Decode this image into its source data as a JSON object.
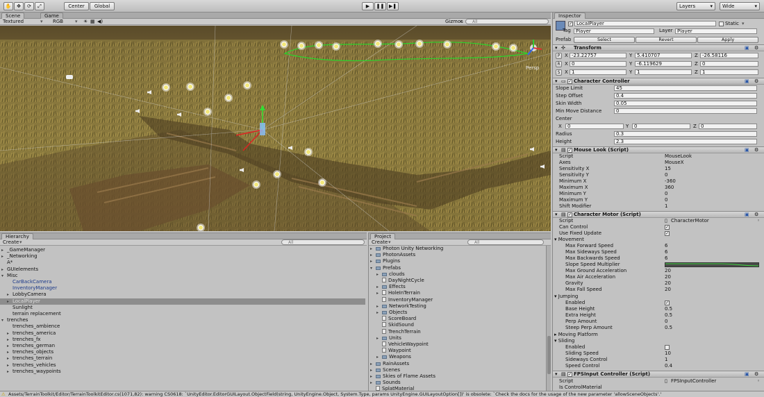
{
  "toolbar": {
    "pivot_label": "Center",
    "space_label": "Global",
    "layers_label": "Layers",
    "layout_label": "Wide"
  },
  "scene_view": {
    "tab_scene": "Scene",
    "tab_game": "Game",
    "render_mode": "Textured",
    "color_mode": "RGB",
    "gizmos_label": "Gizmos",
    "search_placeholder": "All",
    "persp_label": "Persp"
  },
  "hierarchy": {
    "tab_label": "Hierarchy",
    "create_label": "Create",
    "search_placeholder": "All",
    "items": [
      {
        "label": "_GameManager",
        "indent": 0,
        "arrow": "▸",
        "style": ""
      },
      {
        "label": "_Networking",
        "indent": 0,
        "arrow": "▸",
        "style": ""
      },
      {
        "label": "A*",
        "indent": 0,
        "arrow": "",
        "style": ""
      },
      {
        "label": "GUIelements",
        "indent": 0,
        "arrow": "▸",
        "style": ""
      },
      {
        "label": "Misc",
        "indent": 0,
        "arrow": "▾",
        "style": ""
      },
      {
        "label": "CarBackCamera",
        "indent": 1,
        "arrow": "",
        "style": "blue"
      },
      {
        "label": "InventoryManager",
        "indent": 1,
        "arrow": "",
        "style": "blue"
      },
      {
        "label": "LobbyCamera",
        "indent": 1,
        "arrow": "▸",
        "style": ""
      },
      {
        "label": "LocalPlayer",
        "indent": 1,
        "arrow": "▸",
        "style": "sel"
      },
      {
        "label": "Sunlight",
        "indent": 1,
        "arrow": "",
        "style": ""
      },
      {
        "label": "terrain replacement",
        "indent": 1,
        "arrow": "",
        "style": ""
      },
      {
        "label": "trenches",
        "indent": 0,
        "arrow": "▾",
        "style": ""
      },
      {
        "label": "trenches_ambience",
        "indent": 1,
        "arrow": "",
        "style": ""
      },
      {
        "label": "trenches_america",
        "indent": 1,
        "arrow": "▸",
        "style": ""
      },
      {
        "label": "trenches_fx",
        "indent": 1,
        "arrow": "▸",
        "style": ""
      },
      {
        "label": "trenches_german",
        "indent": 1,
        "arrow": "▸",
        "style": ""
      },
      {
        "label": "trenches_objects",
        "indent": 1,
        "arrow": "▸",
        "style": ""
      },
      {
        "label": "trenches_terrain",
        "indent": 1,
        "arrow": "▸",
        "style": ""
      },
      {
        "label": "trenches_vehicles",
        "indent": 1,
        "arrow": "▸",
        "style": ""
      },
      {
        "label": "trenches_waypoints",
        "indent": 1,
        "arrow": "▸",
        "style": ""
      }
    ]
  },
  "project": {
    "tab_label": "Project",
    "create_label": "Create",
    "search_placeholder": "All",
    "items": [
      {
        "label": "Photon Unity Networking",
        "indent": 0,
        "arrow": "▸",
        "kind": "folder"
      },
      {
        "label": "PhotonAssets",
        "indent": 0,
        "arrow": "▸",
        "kind": "folder"
      },
      {
        "label": "Plugins",
        "indent": 0,
        "arrow": "▸",
        "kind": "folder"
      },
      {
        "label": "Prefabs",
        "indent": 0,
        "arrow": "▾",
        "kind": "folder"
      },
      {
        "label": "clouds",
        "indent": 1,
        "arrow": "▸",
        "kind": "folder"
      },
      {
        "label": "DayNightCycle",
        "indent": 1,
        "arrow": "",
        "kind": "file"
      },
      {
        "label": "Effects",
        "indent": 1,
        "arrow": "▸",
        "kind": "folder"
      },
      {
        "label": "HoleInTerrain",
        "indent": 1,
        "arrow": "▸",
        "kind": "file"
      },
      {
        "label": "InventoryManager",
        "indent": 1,
        "arrow": "",
        "kind": "file"
      },
      {
        "label": "NetworkTesting",
        "indent": 1,
        "arrow": "▸",
        "kind": "folder"
      },
      {
        "label": "Objects",
        "indent": 1,
        "arrow": "▸",
        "kind": "folder"
      },
      {
        "label": "ScoreBoard",
        "indent": 1,
        "arrow": "",
        "kind": "file"
      },
      {
        "label": "SkidSound",
        "indent": 1,
        "arrow": "",
        "kind": "file"
      },
      {
        "label": "TrenchTerrain",
        "indent": 1,
        "arrow": "",
        "kind": "file"
      },
      {
        "label": "Units",
        "indent": 1,
        "arrow": "▸",
        "kind": "folder"
      },
      {
        "label": "VehicleWaypoint",
        "indent": 1,
        "arrow": "",
        "kind": "file"
      },
      {
        "label": "Waypoint",
        "indent": 1,
        "arrow": "",
        "kind": "file"
      },
      {
        "label": "Weapons",
        "indent": 1,
        "arrow": "▸",
        "kind": "folder"
      },
      {
        "label": "RainAssets",
        "indent": 0,
        "arrow": "▸",
        "kind": "folder"
      },
      {
        "label": "Scenes",
        "indent": 0,
        "arrow": "▸",
        "kind": "folder"
      },
      {
        "label": "Skies of Flame Assets",
        "indent": 0,
        "arrow": "▸",
        "kind": "folder"
      },
      {
        "label": "Sounds",
        "indent": 0,
        "arrow": "▸",
        "kind": "folder"
      },
      {
        "label": "SplatMaterial",
        "indent": 0,
        "arrow": "",
        "kind": "file"
      }
    ]
  },
  "inspector": {
    "tab_label": "Inspector",
    "object_name": "LocalPlayer",
    "static_label": "Static",
    "tag_label": "Tag",
    "tag_value": "Player",
    "layer_label": "Layer",
    "layer_value": "Player",
    "prefab_label": "Prefab",
    "select_label": "Select",
    "revert_label": "Revert",
    "apply_label": "Apply",
    "transform": {
      "title": "Transform",
      "p_label": "P",
      "r_label": "R",
      "s_label": "S",
      "position": {
        "x": "-23.22757",
        "y": "5.410707",
        "z": "-26.58116"
      },
      "rotation": {
        "x": "0",
        "y": "-6.119629",
        "z": "0"
      },
      "scale": {
        "x": "1",
        "y": "1",
        "z": "1"
      }
    },
    "character_controller": {
      "title": "Character Controller",
      "slope_limit_label": "Slope Limit",
      "slope_limit": "45",
      "step_offset_label": "Step Offset",
      "step_offset": "0.4",
      "skin_width_label": "Skin Width",
      "skin_width": "0.05",
      "min_move_label": "Min Move Distance",
      "min_move": "0",
      "center_label": "Center",
      "center": {
        "x": "0",
        "y": "0",
        "z": "0"
      },
      "radius_label": "Radius",
      "radius": "0.3",
      "height_label": "Height",
      "height": "2.3"
    },
    "mouse_look": {
      "title": "Mouse Look (Script)",
      "rows": [
        {
          "label": "Script",
          "value": "MouseLook"
        },
        {
          "label": "Axes",
          "value": "MouseX"
        },
        {
          "label": "Sensitivity X",
          "value": "15"
        },
        {
          "label": "Sensitivity Y",
          "value": "0"
        },
        {
          "label": "Minimum X",
          "value": "-360"
        },
        {
          "label": "Maximum X",
          "value": "360"
        },
        {
          "label": "Minimum Y",
          "value": "0"
        },
        {
          "label": "Maximum Y",
          "value": "0"
        },
        {
          "label": "Shift Modifier",
          "value": "1"
        }
      ]
    },
    "character_motor": {
      "title": "Character Motor (Script)",
      "script_label": "Script",
      "script_value": "CharacterMotor",
      "can_control_label": "Can Control",
      "fixed_update_label": "Use Fixed Update",
      "movement_label": "Movement",
      "movement_rows": [
        {
          "label": "Max Forward Speed",
          "value": "6"
        },
        {
          "label": "Max Sideways Speed",
          "value": "6"
        },
        {
          "label": "Max Backwards Speed",
          "value": "6"
        },
        {
          "label": "Slope Speed Multiplier",
          "value": ""
        },
        {
          "label": "Max Ground Acceleration",
          "value": "20"
        },
        {
          "label": "Max Air Acceleration",
          "value": "20"
        },
        {
          "label": "Gravity",
          "value": "20"
        },
        {
          "label": "Max Fall Speed",
          "value": "20"
        }
      ],
      "jumping_label": "Jumping",
      "jumping_rows": [
        {
          "label": "Enabled",
          "value": "check"
        },
        {
          "label": "Base Height",
          "value": "0.5"
        },
        {
          "label": "Extra Height",
          "value": "0.5"
        },
        {
          "label": "Perp Amount",
          "value": "0"
        },
        {
          "label": "Steep Perp Amount",
          "value": "0.5"
        }
      ],
      "moving_platform_label": "Moving Platform",
      "sliding_label": "Sliding",
      "sliding_rows": [
        {
          "label": "Enabled",
          "value": "box"
        },
        {
          "label": "Sliding Speed",
          "value": "10"
        },
        {
          "label": "Sideways Control",
          "value": "1"
        },
        {
          "label": "Speed Control",
          "value": "0.4"
        }
      ]
    },
    "fps_input": {
      "title": "FPSInput Controller (Script)",
      "script_label": "Script",
      "script_value": "FPSInputController",
      "is_control_label": "Is ControlMaterial"
    }
  },
  "status": {
    "message": "Assets/TerrainToolkit/Editor/TerrainToolkitEditor.cs(1071,82): warning CS0618: `UnityEditor.EditorGUILayout.ObjectField(string, UnityEngine.Object, System.Type, params UnityEngine.GUILayoutOption[])' is obsolete: `Check the docs for the usage of the new parameter 'allowSceneObjects'.'"
  }
}
